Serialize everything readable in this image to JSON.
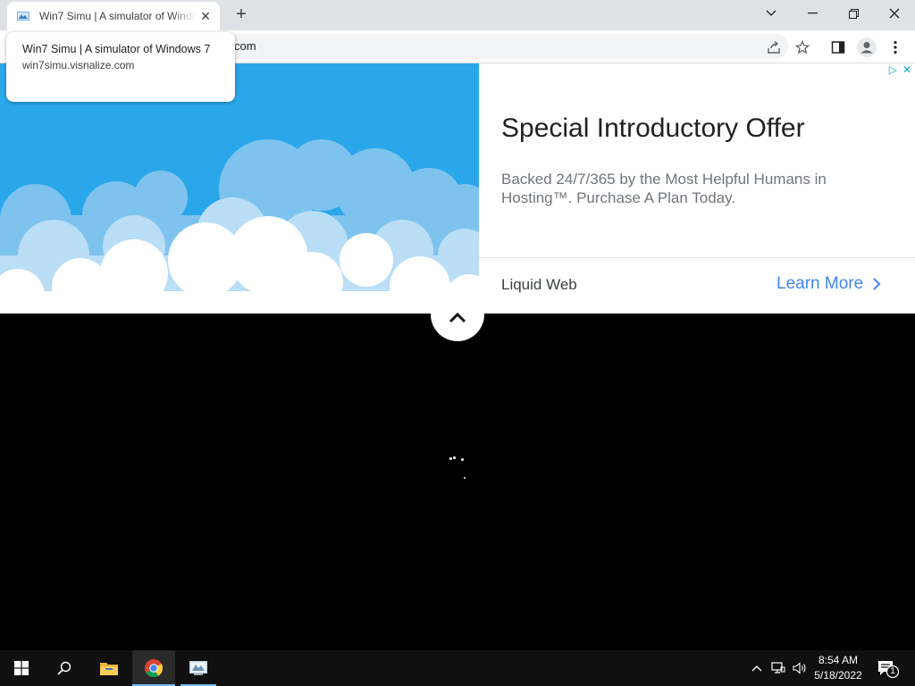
{
  "browser": {
    "tab_title": "Win7 Simu | A simulator of Windows 7",
    "url_suffix": "com",
    "tooltip": {
      "title": "Win7 Simu | A simulator of Windows 7",
      "url": "win7simu.visnalize.com"
    }
  },
  "ad": {
    "headline": "Special Introductory Offer",
    "body": "Backed 24/7/365 by the Most Helpful Humans in Hosting™. Purchase A Plan Today.",
    "advertiser": "Liquid Web",
    "cta": "Learn More"
  },
  "taskbar": {
    "time": "8:54 AM",
    "date": "5/18/2022",
    "notification_count": "1",
    "apps": [
      "start-icon",
      "search-icon",
      "file-explorer-icon",
      "chrome-icon",
      "win7simu-icon"
    ]
  },
  "colors": {
    "accent": "#4285f4",
    "sky": "#2aa7eb",
    "taskbar": "#101010"
  }
}
